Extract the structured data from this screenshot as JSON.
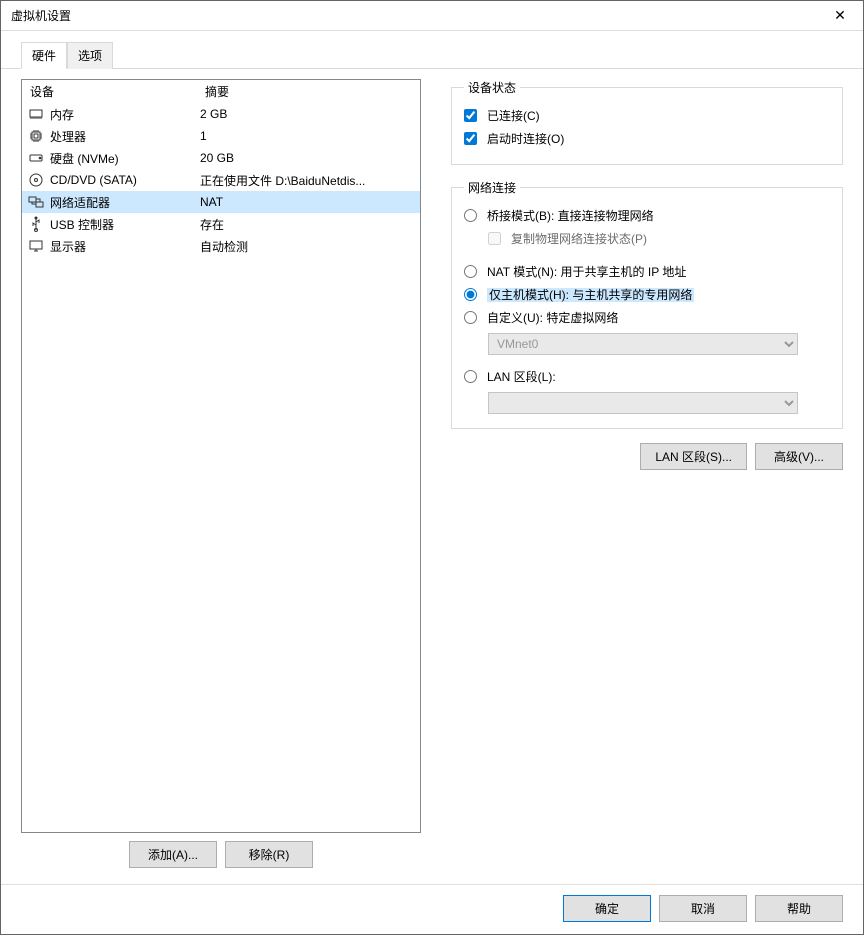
{
  "window": {
    "title": "虚拟机设置"
  },
  "tabs": {
    "hardware": "硬件",
    "options": "选项"
  },
  "device_list": {
    "header_device": "设备",
    "header_summary": "摘要",
    "items": [
      {
        "name": "内存",
        "summary": "2 GB"
      },
      {
        "name": "处理器",
        "summary": "1"
      },
      {
        "name": "硬盘 (NVMe)",
        "summary": "20 GB"
      },
      {
        "name": "CD/DVD (SATA)",
        "summary": "正在使用文件 D:\\BaiduNetdis..."
      },
      {
        "name": "网络适配器",
        "summary": "NAT"
      },
      {
        "name": "USB 控制器",
        "summary": "存在"
      },
      {
        "name": "显示器",
        "summary": "自动检测"
      }
    ]
  },
  "left_buttons": {
    "add": "添加(A)...",
    "remove": "移除(R)"
  },
  "device_status": {
    "legend": "设备状态",
    "connected": "已连接(C)",
    "connect_at_poweron": "启动时连接(O)"
  },
  "network": {
    "legend": "网络连接",
    "bridged": "桥接模式(B): 直接连接物理网络",
    "replicate": "复制物理网络连接状态(P)",
    "nat": "NAT 模式(N): 用于共享主机的 IP 地址",
    "hostonly": "仅主机模式(H): 与主机共享的专用网络",
    "custom": "自定义(U): 特定虚拟网络",
    "custom_select": "VMnet0",
    "lanseg": "LAN 区段(L):",
    "lanseg_select": ""
  },
  "right_buttons": {
    "lan_segments": "LAN 区段(S)...",
    "advanced": "高级(V)..."
  },
  "footer": {
    "ok": "确定",
    "cancel": "取消",
    "help": "帮助"
  }
}
